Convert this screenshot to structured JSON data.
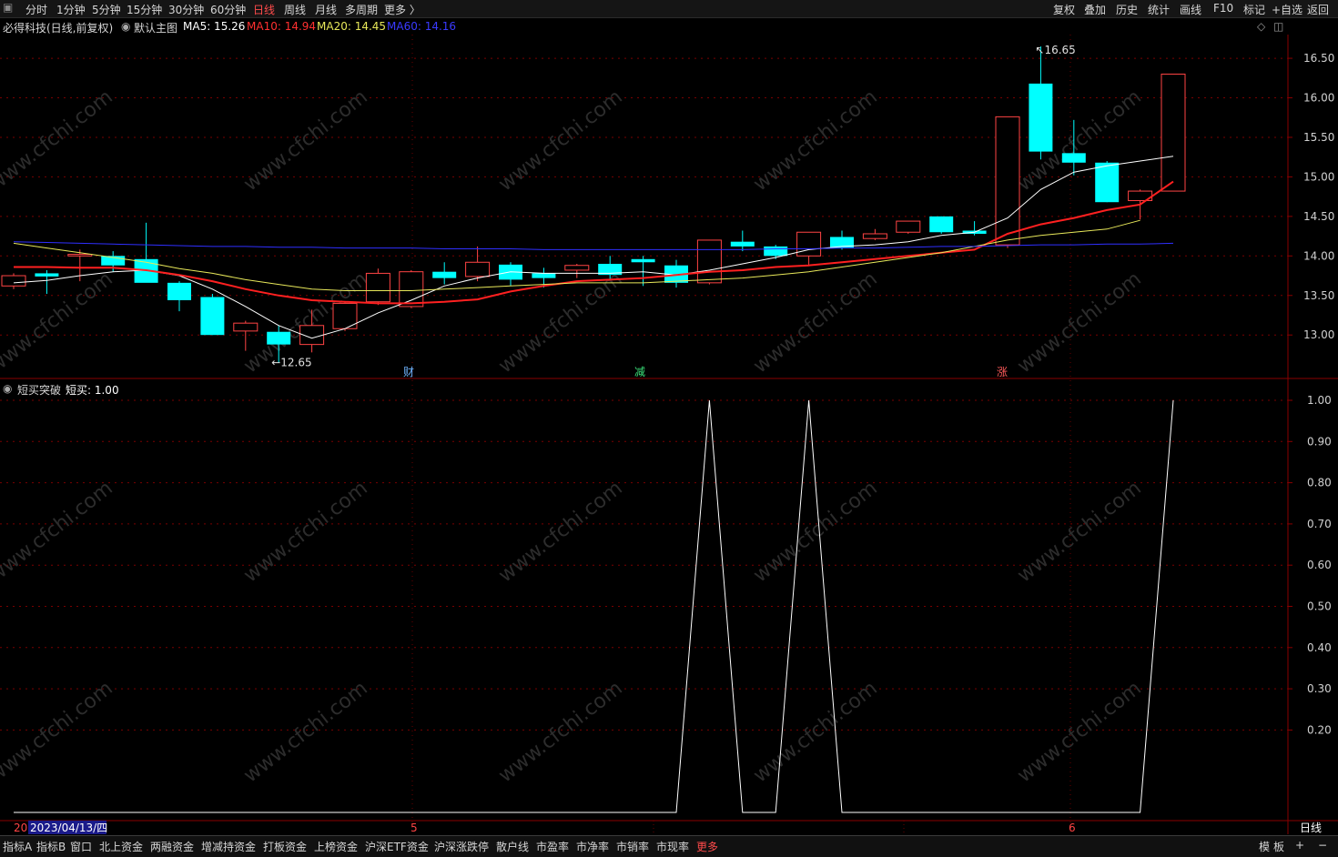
{
  "toolbar": {
    "period_tabs": [
      "分时",
      "1分钟",
      "5分钟",
      "15分钟",
      "30分钟",
      "60分钟",
      "日线",
      "周线",
      "月线",
      "多周期",
      "更多 〉"
    ],
    "active_period": "日线",
    "right_buttons": [
      "复权",
      "叠加",
      "历史",
      "统计",
      "画线",
      "F10",
      "标记",
      "+自选",
      "返回"
    ]
  },
  "main_title": {
    "stock": "必得科技(日线,前复权)",
    "template": "默认主图",
    "ma5_label": "MA5: 15.26",
    "ma10_label": "MA10: 14.94",
    "ma20_label": "MA20: 14.45",
    "ma60_label": "MA60: 14.16"
  },
  "indicator_title": {
    "name": "短买突破",
    "value_label": "短买: 1.00"
  },
  "price_axis": [
    "16.50",
    "16.00",
    "15.50",
    "15.00",
    "14.50",
    "14.00",
    "13.50",
    "13.00"
  ],
  "indicator_axis": [
    "1.00",
    "0.90",
    "0.80",
    "0.70",
    "0.60",
    "0.50",
    "0.40",
    "0.30",
    "0.20"
  ],
  "markers": {
    "high_label": "16.65",
    "low_label": "12.65",
    "event_cai": "财",
    "event_jian": "减",
    "event_zhang": "涨"
  },
  "date_axis": {
    "left_prefix": "20",
    "cursor_date": "2023/04/13/四",
    "month_5": "5",
    "month_6": "6",
    "period_label": "日线"
  },
  "bottom_tabs": [
    "指标A",
    "指标B",
    "窗口",
    "北上资金",
    "两融资金",
    "增减持资金",
    "打板资金",
    "上榜资金",
    "沪深ETF资金",
    "沪深涨跌停",
    "散户线",
    "市盈率",
    "市净率",
    "市销率",
    "市现率",
    "更多"
  ],
  "bottom_right": [
    "模",
    "板",
    "+",
    "−"
  ],
  "colors": {
    "up": "#ff4444",
    "down": "#00ffff",
    "ma5": "#ffffff",
    "ma10": "#ff2020",
    "ma20": "#e8e85a",
    "ma60": "#2f2fff",
    "grid": "#7a0000"
  },
  "watermark": "www.cfchi.com",
  "chart_data": [
    {
      "type": "candlestick",
      "title": "必得科技(日线,前复权)",
      "ylim": [
        12.45,
        16.8
      ],
      "candles": [
        {
          "o": 13.62,
          "h": 13.78,
          "l": 13.58,
          "c": 13.75
        },
        {
          "o": 13.78,
          "h": 13.82,
          "l": 13.52,
          "c": 13.74
        },
        {
          "o": 14.0,
          "h": 14.08,
          "l": 13.68,
          "c": 14.02
        },
        {
          "o": 14.0,
          "h": 14.06,
          "l": 13.8,
          "c": 13.88
        },
        {
          "o": 13.96,
          "h": 14.42,
          "l": 13.68,
          "c": 13.66
        },
        {
          "o": 13.66,
          "h": 13.68,
          "l": 13.3,
          "c": 13.44
        },
        {
          "o": 13.48,
          "h": 13.52,
          "l": 13.0,
          "c": 13.0
        },
        {
          "o": 13.05,
          "h": 13.18,
          "l": 12.8,
          "c": 13.15
        },
        {
          "o": 13.04,
          "h": 13.12,
          "l": 12.65,
          "c": 12.88
        },
        {
          "o": 12.88,
          "h": 13.32,
          "l": 12.78,
          "c": 13.12
        },
        {
          "o": 13.08,
          "h": 13.42,
          "l": 13.05,
          "c": 13.4
        },
        {
          "o": 13.42,
          "h": 13.84,
          "l": 13.38,
          "c": 13.78
        },
        {
          "o": 13.36,
          "h": 13.82,
          "l": 13.34,
          "c": 13.8
        },
        {
          "o": 13.8,
          "h": 13.92,
          "l": 13.64,
          "c": 13.72
        },
        {
          "o": 13.74,
          "h": 14.12,
          "l": 13.68,
          "c": 13.92
        },
        {
          "o": 13.89,
          "h": 13.92,
          "l": 13.62,
          "c": 13.7
        },
        {
          "o": 13.78,
          "h": 13.85,
          "l": 13.6,
          "c": 13.72
        },
        {
          "o": 13.82,
          "h": 13.9,
          "l": 13.72,
          "c": 13.88
        },
        {
          "o": 13.9,
          "h": 14.0,
          "l": 13.7,
          "c": 13.76
        },
        {
          "o": 13.96,
          "h": 14.0,
          "l": 13.62,
          "c": 13.92
        },
        {
          "o": 13.88,
          "h": 13.95,
          "l": 13.6,
          "c": 13.66
        },
        {
          "o": 13.66,
          "h": 14.2,
          "l": 13.64,
          "c": 14.2
        },
        {
          "o": 14.18,
          "h": 14.32,
          "l": 14.06,
          "c": 14.12
        },
        {
          "o": 14.12,
          "h": 14.14,
          "l": 13.96,
          "c": 14.0
        },
        {
          "o": 14.0,
          "h": 14.3,
          "l": 13.88,
          "c": 14.3
        },
        {
          "o": 14.24,
          "h": 14.32,
          "l": 14.08,
          "c": 14.1
        },
        {
          "o": 14.22,
          "h": 14.34,
          "l": 14.2,
          "c": 14.28
        },
        {
          "o": 14.3,
          "h": 14.44,
          "l": 14.28,
          "c": 14.44
        },
        {
          "o": 14.5,
          "h": 14.5,
          "l": 14.28,
          "c": 14.3
        },
        {
          "o": 14.32,
          "h": 14.44,
          "l": 14.26,
          "c": 14.28
        },
        {
          "o": 14.14,
          "h": 15.76,
          "l": 14.1,
          "c": 15.76
        },
        {
          "o": 16.18,
          "h": 16.65,
          "l": 15.22,
          "c": 15.32
        },
        {
          "o": 15.3,
          "h": 15.72,
          "l": 15.02,
          "c": 15.18
        },
        {
          "o": 15.18,
          "h": 15.2,
          "l": 14.68,
          "c": 14.68
        },
        {
          "o": 14.7,
          "h": 14.84,
          "l": 14.46,
          "c": 14.82
        },
        {
          "o": 14.82,
          "h": 16.3,
          "l": 14.82,
          "c": 16.3
        }
      ],
      "series": [
        {
          "name": "MA5",
          "values": [
            13.66,
            13.69,
            13.75,
            13.8,
            13.82,
            13.75,
            13.58,
            13.36,
            13.12,
            12.96,
            13.08,
            13.28,
            13.44,
            13.62,
            13.72,
            13.8,
            13.78,
            13.78,
            13.78,
            13.8,
            13.76,
            13.82,
            13.9,
            13.98,
            14.08,
            14.12,
            14.14,
            14.18,
            14.26,
            14.3,
            14.48,
            14.84,
            15.06,
            15.14,
            15.2,
            15.26
          ]
        },
        {
          "name": "MA10",
          "values": [
            13.86,
            13.86,
            13.85,
            13.85,
            13.82,
            13.76,
            13.68,
            13.58,
            13.5,
            13.44,
            13.42,
            13.4,
            13.4,
            13.42,
            13.45,
            13.55,
            13.62,
            13.68,
            13.7,
            13.72,
            13.76,
            13.8,
            13.82,
            13.86,
            13.88,
            13.92,
            13.96,
            14.0,
            14.04,
            14.08,
            14.28,
            14.4,
            14.48,
            14.58,
            14.65,
            14.94
          ]
        },
        {
          "name": "MA20",
          "values": [
            14.16,
            14.1,
            14.04,
            13.98,
            13.92,
            13.84,
            13.78,
            13.7,
            13.64,
            13.58,
            13.56,
            13.56,
            13.56,
            13.58,
            13.6,
            13.62,
            13.64,
            13.66,
            13.66,
            13.66,
            13.68,
            13.7,
            13.72,
            13.76,
            13.8,
            13.86,
            13.92,
            13.98,
            14.04,
            14.12,
            14.2,
            14.26,
            14.3,
            14.34,
            14.45
          ]
        },
        {
          "name": "MA60",
          "values": [
            14.18,
            14.17,
            14.16,
            14.15,
            14.14,
            14.13,
            14.12,
            14.12,
            14.11,
            14.11,
            14.1,
            14.1,
            14.1,
            14.09,
            14.09,
            14.09,
            14.08,
            14.08,
            14.08,
            14.08,
            14.08,
            14.08,
            14.08,
            14.09,
            14.09,
            14.1,
            14.1,
            14.11,
            14.12,
            14.12,
            14.13,
            14.14,
            14.14,
            14.15,
            14.15,
            14.16
          ]
        }
      ]
    },
    {
      "type": "line",
      "title": "短买突破",
      "ylim": [
        0,
        1.0
      ],
      "series": [
        {
          "name": "短买",
          "values": [
            0,
            0,
            0,
            0,
            0,
            0,
            0,
            0,
            0,
            0,
            0,
            0,
            0,
            0,
            0,
            0,
            0,
            0,
            0,
            0,
            0,
            1,
            0,
            0,
            1,
            0,
            0,
            0,
            0,
            0,
            0,
            0,
            0,
            0,
            0,
            1
          ]
        }
      ]
    }
  ]
}
